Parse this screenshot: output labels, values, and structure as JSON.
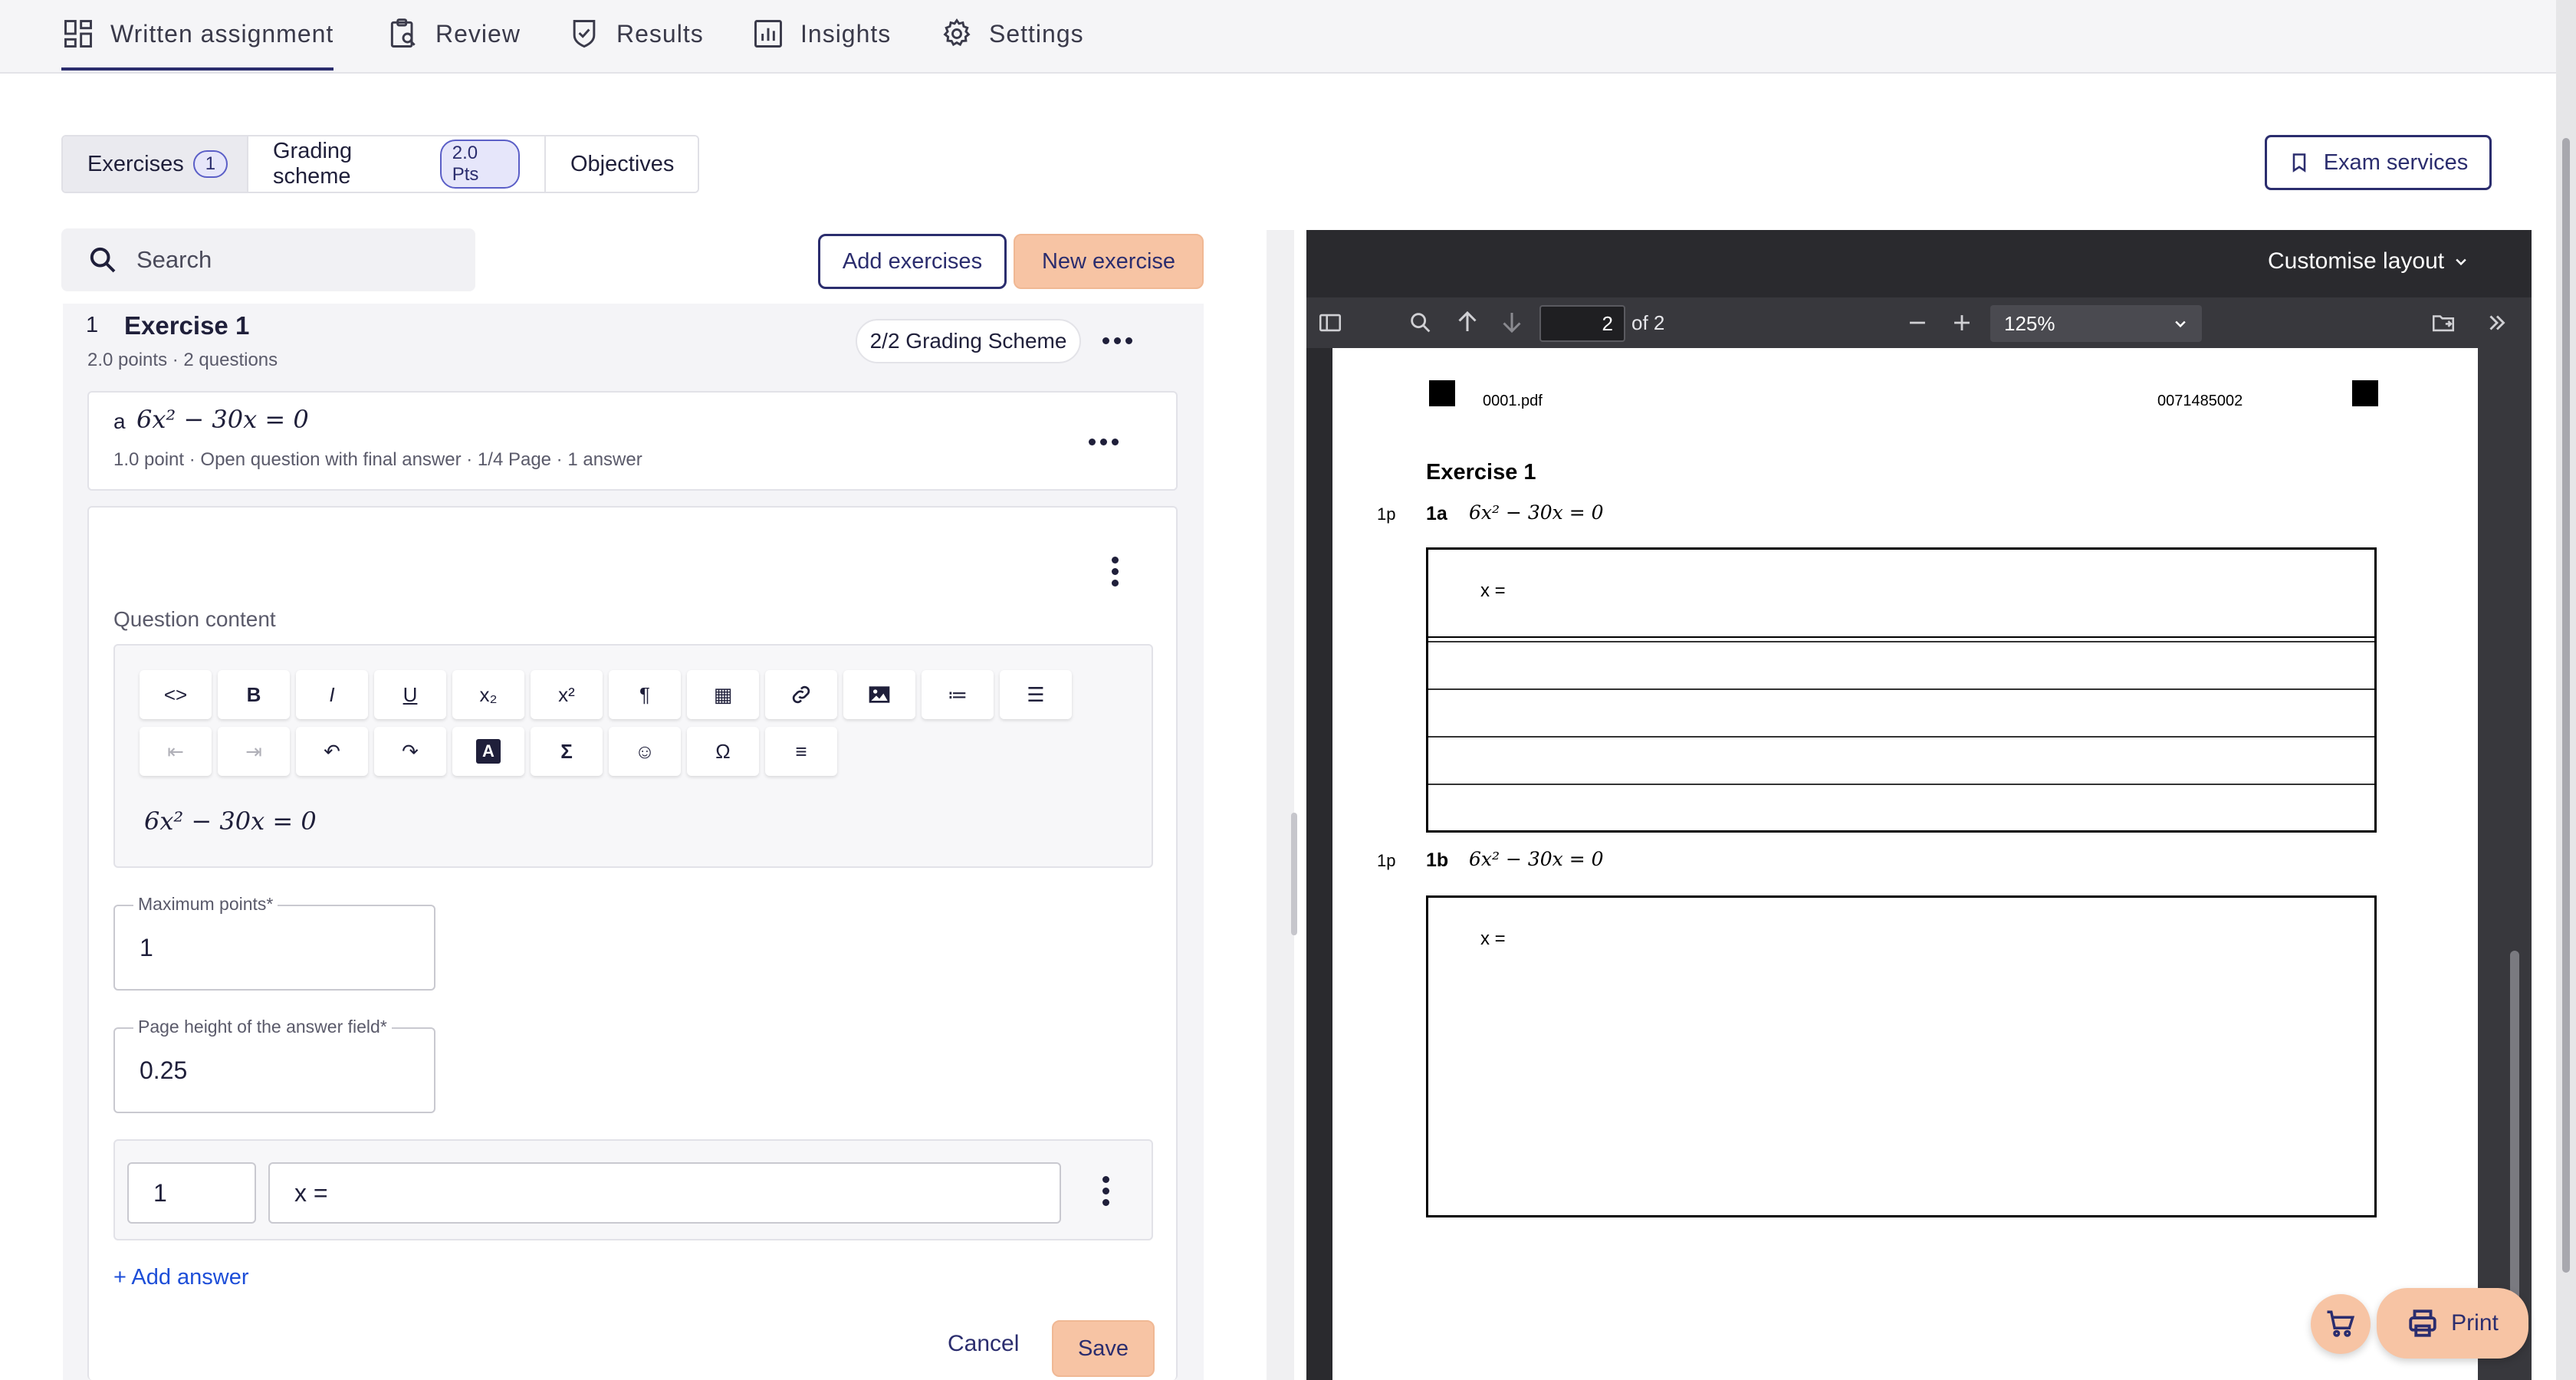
{
  "nav": {
    "items": [
      {
        "label": "Written assignment",
        "icon": "dashboard-icon",
        "active": true
      },
      {
        "label": "Review",
        "icon": "clipboard-search-icon"
      },
      {
        "label": "Results",
        "icon": "shield-check-icon"
      },
      {
        "label": "Insights",
        "icon": "bar-chart-icon"
      },
      {
        "label": "Settings",
        "icon": "gear-icon"
      }
    ]
  },
  "tabs": [
    {
      "label": "Exercises",
      "badge": "1",
      "active": true
    },
    {
      "label": "Grading scheme",
      "badge": "2.0 Pts"
    },
    {
      "label": "Objectives"
    }
  ],
  "exam_services": "Exam services",
  "search": {
    "placeholder": "Search"
  },
  "buttons": {
    "add_exercises": "Add exercises",
    "new_exercise": "New exercise",
    "cancel": "Cancel",
    "save": "Save",
    "add_answer": "+ Add answer"
  },
  "exercise": {
    "number": "1",
    "title": "Exercise 1",
    "meta": "2.0 points · 2 questions",
    "grading_scheme": "2/2 Grading Scheme",
    "question": {
      "letter": "a",
      "formula": "6x² − 30x = 0",
      "meta": "1.0 point · Open question with final answer · 1/4 Page · 1 answer"
    }
  },
  "editor": {
    "section_label": "Question content",
    "content": "6x² − 30x = 0",
    "toolbar_row1": [
      "<>",
      "B",
      "I",
      "U",
      "x₂",
      "x²",
      "¶",
      "▦",
      "🔗",
      "▣",
      "≔",
      "☰"
    ],
    "toolbar_row2": [
      "⇤",
      "⇥",
      "↶",
      "↷",
      "A",
      "Σ",
      "☺",
      "Ω",
      "≡"
    ]
  },
  "fields": {
    "max_points": {
      "label": "Maximum points*",
      "value": "1"
    },
    "page_height": {
      "label": "Page height of the answer field*",
      "value": "0.25"
    }
  },
  "answer": {
    "number": "1",
    "text": "x ="
  },
  "pdf": {
    "customise_layout": "Customise layout",
    "page_input": "2",
    "page_total": "of 2",
    "zoom": "125%",
    "page": {
      "filename": "0001.pdf",
      "code": "0071485002",
      "exercise_title": "Exercise 1",
      "q1": {
        "points": "1p",
        "label": "1a",
        "formula": "6x² − 30x = 0",
        "answer": "x ="
      },
      "q2": {
        "points": "1p",
        "label": "1b",
        "formula": "6x² − 30x = 0",
        "answer": "x ="
      }
    }
  },
  "print_label": "Print",
  "colors": {
    "accent": "#2b2d6e",
    "peach": "#f7c4a4",
    "pdf_bg": "#2a2a2e"
  }
}
